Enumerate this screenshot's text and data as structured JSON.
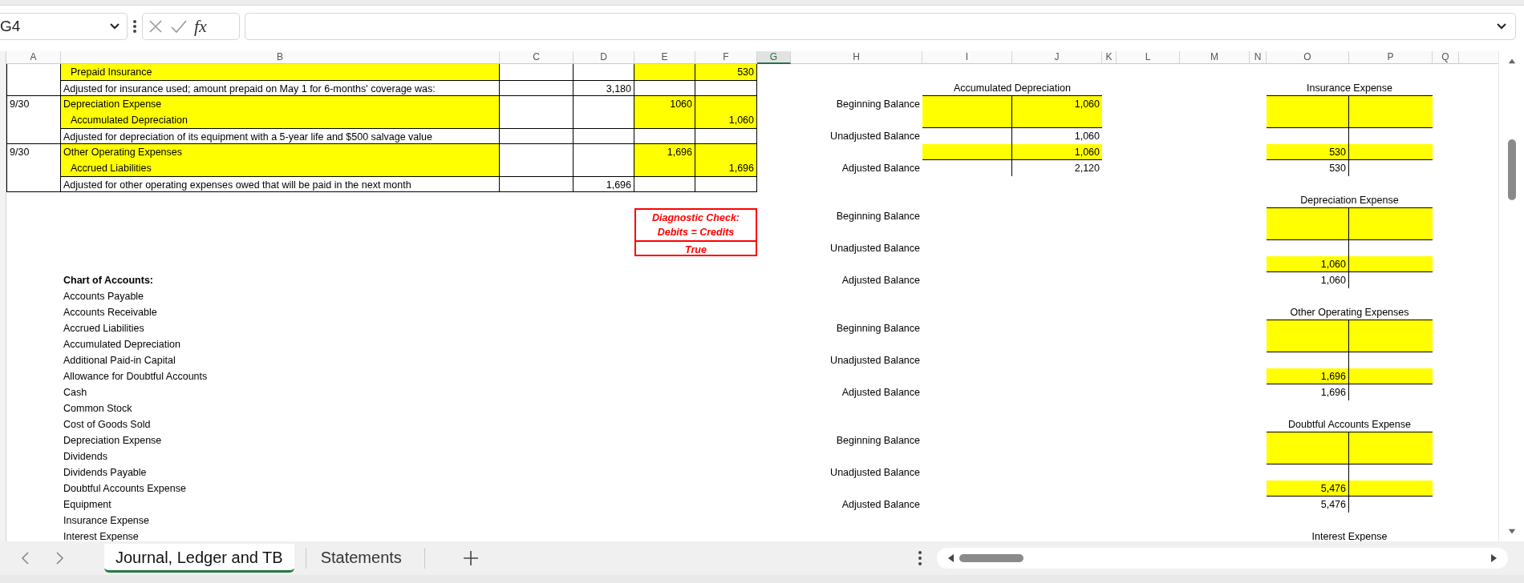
{
  "name_box": {
    "value": "G4"
  },
  "formula_bar": {
    "function_label": "fx"
  },
  "column_headers": [
    {
      "label": "A",
      "selected": false
    },
    {
      "label": "B",
      "selected": false
    },
    {
      "label": "C",
      "selected": false
    },
    {
      "label": "D",
      "selected": false
    },
    {
      "label": "E",
      "selected": false
    },
    {
      "label": "F",
      "selected": false
    },
    {
      "label": "G",
      "selected": true
    },
    {
      "label": "H",
      "selected": false
    },
    {
      "label": "I",
      "selected": false
    },
    {
      "label": "J",
      "selected": false
    },
    {
      "label": "K",
      "selected": false
    },
    {
      "label": "L",
      "selected": false
    },
    {
      "label": "M",
      "selected": false
    },
    {
      "label": "N",
      "selected": false
    },
    {
      "label": "O",
      "selected": false
    },
    {
      "label": "P",
      "selected": false
    },
    {
      "label": "Q",
      "selected": false
    }
  ],
  "journal": [
    {
      "lines": [
        {
          "kind": "credit",
          "account": "Prepaid Insurance",
          "credit": "530"
        },
        {
          "kind": "note",
          "account": "Adjusted for insurance used; amount prepaid on May 1 for 6-months' coverage was:",
          "amount": "3,180"
        }
      ]
    },
    {
      "date": "9/30",
      "lines": [
        {
          "kind": "debit",
          "account": "Depreciation Expense",
          "debit": "1060"
        },
        {
          "kind": "credit",
          "account": "Accumulated Depreciation",
          "credit": "1,060"
        },
        {
          "kind": "note",
          "account": "Adjusted for depreciation of its equipment with a 5-year life and $500 salvage value"
        }
      ]
    },
    {
      "date": "9/30",
      "lines": [
        {
          "kind": "debit",
          "account": "Other Operating Expenses",
          "debit": "1,696"
        },
        {
          "kind": "credit",
          "account": "Accrued Liabilities",
          "credit": "1,696"
        },
        {
          "kind": "note",
          "account": "Adjusted for other operating expenses owed that will be paid in the next month",
          "amount": "1,696"
        }
      ]
    }
  ],
  "diagnostic_check": {
    "lines": [
      "Diagnostic Check:",
      "Debits = Credits"
    ],
    "result": "True"
  },
  "chart_of_accounts": {
    "title": "Chart of Accounts:",
    "accounts": [
      "Accounts Payable",
      "Accounts Receivable",
      "Accrued Liabilities",
      "Accumulated Depreciation",
      "Additional Paid-in Capital",
      "Allowance for Doubtful Accounts",
      "Cash",
      "Common Stock",
      "Cost of Goods Sold",
      "Depreciation Expense",
      "Dividends",
      "Dividends Payable",
      "Doubtful Accounts Expense",
      "Equipment",
      "Insurance Expense",
      "Interest Expense"
    ]
  },
  "ledger": [
    {
      "labels": [
        "Beginning Balance",
        "Unadjusted Balance",
        "Adjusted Balance"
      ],
      "left_account": {
        "title": "Accumulated Depreciation",
        "beginning": {
          "credit": "1,060"
        },
        "unadjusted": {
          "credit": "1,060"
        },
        "adjustment": {
          "credit": "1,060"
        },
        "adjusted": {
          "credit": "2,120"
        }
      },
      "right_account": {
        "title": "Insurance Expense",
        "adjustment": {
          "debit": "530"
        },
        "adjusted": {
          "debit": "530"
        }
      }
    },
    {
      "labels": [
        "Beginning Balance",
        "Unadjusted Balance",
        "Adjusted Balance"
      ],
      "right_account": {
        "title": "Depreciation Expense",
        "adjustment": {
          "debit": "1,060"
        },
        "adjusted": {
          "debit": "1,060"
        }
      }
    },
    {
      "labels": [
        "Beginning Balance",
        "Unadjusted Balance",
        "Adjusted Balance"
      ],
      "right_account": {
        "title": "Other Operating Expenses",
        "adjustment": {
          "debit": "1,696"
        },
        "adjusted": {
          "debit": "1,696"
        }
      }
    },
    {
      "labels": [
        "Beginning Balance",
        "Unadjusted Balance",
        "Adjusted Balance"
      ],
      "right_account": {
        "title": "Doubtful Accounts Expense",
        "adjustment": {
          "debit": "5,476"
        },
        "adjusted": {
          "debit": "5,476"
        }
      }
    },
    {
      "right_account": {
        "title": "Interest Expense"
      }
    }
  ],
  "sheet_tabs": [
    {
      "label": "Journal, Ledger and TB",
      "selected": true
    },
    {
      "label": "Statements",
      "selected": false
    }
  ]
}
